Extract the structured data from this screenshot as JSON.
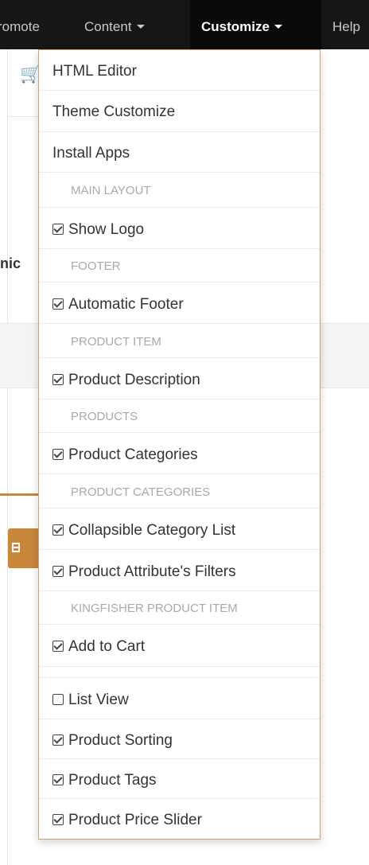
{
  "nav": {
    "items": [
      {
        "label": "romote",
        "dropdown": false
      },
      {
        "label": "Content",
        "dropdown": true
      },
      {
        "label": "Customize",
        "dropdown": true,
        "active": true
      },
      {
        "label": "Help",
        "dropdown": false
      }
    ]
  },
  "page": {
    "partial_heading": "nic",
    "accent_color": "#c8873a"
  },
  "dropdown": {
    "items": [
      {
        "type": "link",
        "label": "HTML Editor"
      },
      {
        "type": "link",
        "label": "Theme Customize"
      },
      {
        "type": "link",
        "label": "Install Apps"
      },
      {
        "type": "header",
        "label": "MAIN LAYOUT"
      },
      {
        "type": "check",
        "label": "Show Logo",
        "checked": true
      },
      {
        "type": "header",
        "label": "FOOTER"
      },
      {
        "type": "check",
        "label": "Automatic Footer",
        "checked": true
      },
      {
        "type": "header",
        "label": "PRODUCT ITEM"
      },
      {
        "type": "check",
        "label": "Product Description",
        "checked": true
      },
      {
        "type": "header",
        "label": "PRODUCTS"
      },
      {
        "type": "check",
        "label": "Product Categories",
        "checked": true
      },
      {
        "type": "header",
        "label": "PRODUCT CATEGORIES"
      },
      {
        "type": "check",
        "label": "Collapsible Category List",
        "checked": true
      },
      {
        "type": "check",
        "label": "Product Attribute's Filters",
        "checked": true
      },
      {
        "type": "header",
        "label": "KINGFISHER PRODUCT ITEM"
      },
      {
        "type": "check",
        "label": "Add to Cart",
        "checked": true
      },
      {
        "type": "spacer",
        "label": ""
      },
      {
        "type": "check",
        "label": "List View",
        "checked": false
      },
      {
        "type": "check",
        "label": "Product Sorting",
        "checked": true
      },
      {
        "type": "check",
        "label": "Product Tags",
        "checked": true
      },
      {
        "type": "check",
        "label": "Product Price Slider",
        "checked": true
      }
    ]
  }
}
